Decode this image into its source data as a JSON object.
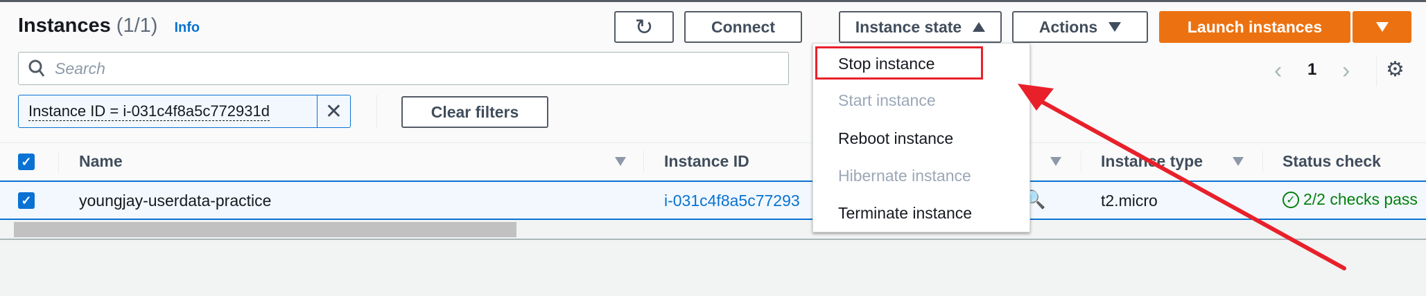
{
  "header": {
    "title": "Instances",
    "count": "(1/1)",
    "info": "Info"
  },
  "toolbar": {
    "connect": "Connect",
    "instance_state": "Instance state",
    "actions": "Actions",
    "launch": "Launch instances"
  },
  "search": {
    "placeholder": "Search"
  },
  "filter": {
    "token": "Instance ID = i-031c4f8a5c772931d",
    "clear": "Clear filters"
  },
  "pagination": {
    "page": "1"
  },
  "columns": [
    "Name",
    "Instance ID",
    "Instance type",
    "Status check"
  ],
  "rows": [
    {
      "name": "youngjay-userdata-practice",
      "instance_id": "i-031c4f8a5c77293",
      "type": "t2.micro",
      "status": "2/2 checks pass"
    }
  ],
  "menu": {
    "items": [
      {
        "label": "Stop instance",
        "enabled": true
      },
      {
        "label": "Start instance",
        "enabled": false
      },
      {
        "label": "Reboot instance",
        "enabled": true
      },
      {
        "label": "Hibernate instance",
        "enabled": false
      },
      {
        "label": "Terminate instance",
        "enabled": true
      }
    ]
  },
  "colors": {
    "accent": "#ec7211",
    "link": "#0972d3",
    "annotation": "#e8202a",
    "success": "#037f0c"
  }
}
